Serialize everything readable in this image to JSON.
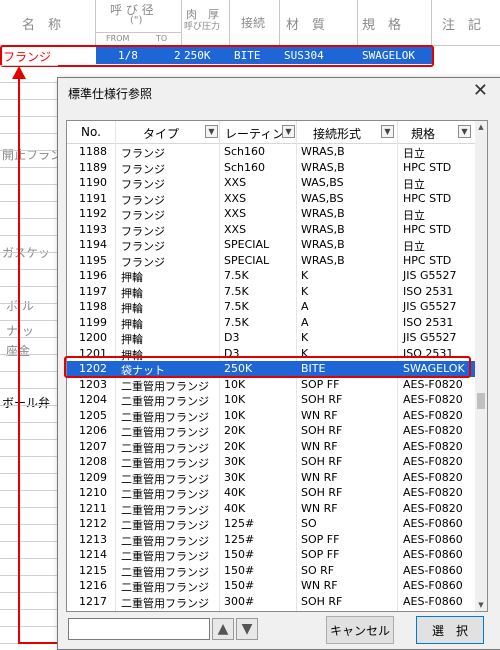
{
  "sheet": {
    "headers": {
      "name": "名　称",
      "nominal": "呼 び 径",
      "nominal_unit": "(\")",
      "thickness": "肉　厚",
      "pressure": "呼び圧力",
      "connection": "接続",
      "material": "材　質",
      "standard": "規　格",
      "note": "注　記",
      "from": "FROM",
      "to": "TO"
    },
    "row": {
      "name": "フランジ",
      "from": "1/8",
      "to": "2",
      "rating": "250K",
      "connection": "BITE",
      "material": "SUS304",
      "standard": "SWAGELOK",
      "note": ".."
    },
    "side_labels": [
      "開止フラン",
      "ガスケッ",
      "ボ ル",
      "ナ ッ",
      "座金",
      "ボール弁"
    ]
  },
  "dialog": {
    "title": "標準仕様行参照",
    "close": "✕",
    "columns": [
      "No.",
      "タイプ",
      "レーティン",
      "接続形式",
      "規格"
    ],
    "rows": [
      [
        "1188",
        "フランジ",
        "Sch160",
        "WRAS,B",
        "日立"
      ],
      [
        "1189",
        "フランジ",
        "Sch160",
        "WRAS,B",
        "HPC STD"
      ],
      [
        "1190",
        "フランジ",
        "XXS",
        "WAS,BS",
        "日立"
      ],
      [
        "1191",
        "フランジ",
        "XXS",
        "WAS,BS",
        "HPC STD"
      ],
      [
        "1192",
        "フランジ",
        "XXS",
        "WRAS,B",
        "日立"
      ],
      [
        "1193",
        "フランジ",
        "XXS",
        "WRAS,B",
        "HPC STD"
      ],
      [
        "1194",
        "フランジ",
        "SPECIAL",
        "WRAS,B",
        "日立"
      ],
      [
        "1195",
        "フランジ",
        "SPECIAL",
        "WRAS,B",
        "HPC STD"
      ],
      [
        "1196",
        "押輪",
        "7.5K",
        "K",
        "JIS G5527"
      ],
      [
        "1197",
        "押輪",
        "7.5K",
        "K",
        "ISO 2531"
      ],
      [
        "1198",
        "押輪",
        "7.5K",
        "A",
        "JIS G5527"
      ],
      [
        "1199",
        "押輪",
        "7.5K",
        "A",
        "ISO 2531"
      ],
      [
        "1200",
        "押輪",
        "D3",
        "K",
        "JIS G5527"
      ],
      [
        "1201",
        "押輪",
        "D3",
        "K",
        "ISO 2531"
      ],
      [
        "1202",
        "袋ナット",
        "250K",
        "BITE",
        "SWAGELOK"
      ],
      [
        "1203",
        "二重管用フランジ",
        "10K",
        "SOP FF",
        "AES-F0820"
      ],
      [
        "1204",
        "二重管用フランジ",
        "10K",
        "SOH RF",
        "AES-F0820"
      ],
      [
        "1205",
        "二重管用フランジ",
        "10K",
        "WN RF",
        "AES-F0820"
      ],
      [
        "1206",
        "二重管用フランジ",
        "20K",
        "SOH RF",
        "AES-F0820"
      ],
      [
        "1207",
        "二重管用フランジ",
        "20K",
        "WN RF",
        "AES-F0820"
      ],
      [
        "1208",
        "二重管用フランジ",
        "30K",
        "SOH RF",
        "AES-F0820"
      ],
      [
        "1209",
        "二重管用フランジ",
        "30K",
        "WN RF",
        "AES-F0820"
      ],
      [
        "1210",
        "二重管用フランジ",
        "40K",
        "SOH RF",
        "AES-F0820"
      ],
      [
        "1211",
        "二重管用フランジ",
        "40K",
        "WN RF",
        "AES-F0820"
      ],
      [
        "1212",
        "二重管用フランジ",
        "125#",
        "SO",
        "AES-F0860"
      ],
      [
        "1213",
        "二重管用フランジ",
        "125#",
        "SOP FF",
        "AES-F0860"
      ],
      [
        "1214",
        "二重管用フランジ",
        "150#",
        "SOP FF",
        "AES-F0860"
      ],
      [
        "1215",
        "二重管用フランジ",
        "150#",
        "SO RF",
        "AES-F0860"
      ],
      [
        "1216",
        "二重管用フランジ",
        "150#",
        "WN RF",
        "AES-F0860"
      ],
      [
        "1217",
        "二重管用フランジ",
        "300#",
        "SOH RF",
        "AES-F0860"
      ]
    ],
    "selected_index": 14,
    "search_value": "",
    "up_icon": "▲",
    "down_icon": "▼",
    "cancel_label": "キャンセル",
    "select_label": "選　択"
  },
  "colors": {
    "selection": "#1e66d6",
    "highlight": "#e30000"
  }
}
